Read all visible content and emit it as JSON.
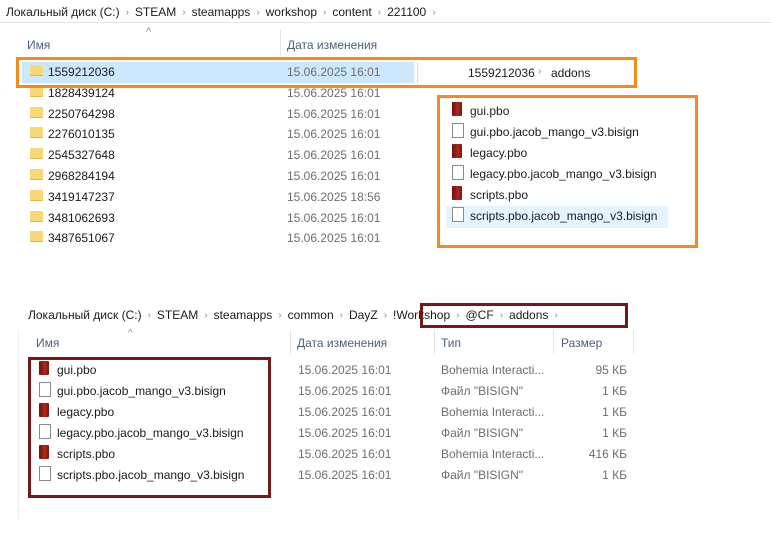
{
  "top": {
    "breadcrumb": [
      "Локальный диск (C:)",
      "STEAM",
      "steamapps",
      "workshop",
      "content",
      "221100"
    ],
    "columns": {
      "name": "Имя",
      "date": "Дата изменения"
    },
    "folders": [
      {
        "name": "1559212036",
        "date": "15.06.2025 16:01"
      },
      {
        "name": "1828439124",
        "date": "15.06.2025 16:01"
      },
      {
        "name": "2250764298",
        "date": "15.06.2025 16:01"
      },
      {
        "name": "2276010135",
        "date": "15.06.2025 16:01"
      },
      {
        "name": "2545327648",
        "date": "15.06.2025 16:01"
      },
      {
        "name": "2968284194",
        "date": "15.06.2025 16:01"
      },
      {
        "name": "3419147237",
        "date": "15.06.2025 18:56"
      },
      {
        "name": "3481062693",
        "date": "15.06.2025 16:01"
      },
      {
        "name": "3487651067",
        "date": "15.06.2025 16:01"
      }
    ],
    "inner_breadcrumb": [
      "1559212036",
      "addons"
    ],
    "inner_files": [
      {
        "name": "gui.pbo",
        "icon": "pbo"
      },
      {
        "name": "gui.pbo.jacob_mango_v3.bisign",
        "icon": "doc"
      },
      {
        "name": "legacy.pbo",
        "icon": "pbo"
      },
      {
        "name": "legacy.pbo.jacob_mango_v3.bisign",
        "icon": "doc"
      },
      {
        "name": "scripts.pbo",
        "icon": "pbo"
      },
      {
        "name": "scripts.pbo.jacob_mango_v3.bisign",
        "icon": "doc"
      }
    ]
  },
  "bottom": {
    "breadcrumb": [
      "Локальный диск (C:)",
      "STEAM",
      "steamapps",
      "common",
      "DayZ",
      "!Workshop",
      "@CF",
      "addons"
    ],
    "columns": {
      "name": "Имя",
      "date": "Дата изменения",
      "type": "Тип",
      "size": "Размер"
    },
    "files": [
      {
        "name": "gui.pbo",
        "icon": "pbo",
        "date": "15.06.2025 16:01",
        "type": "Bohemia Interacti...",
        "size": "95 КБ"
      },
      {
        "name": "gui.pbo.jacob_mango_v3.bisign",
        "icon": "doc",
        "date": "15.06.2025 16:01",
        "type": "Файл \"BISIGN\"",
        "size": "1 КБ"
      },
      {
        "name": "legacy.pbo",
        "icon": "pbo",
        "date": "15.06.2025 16:01",
        "type": "Bohemia Interacti...",
        "size": "1 КБ"
      },
      {
        "name": "legacy.pbo.jacob_mango_v3.bisign",
        "icon": "doc",
        "date": "15.06.2025 16:01",
        "type": "Файл \"BISIGN\"",
        "size": "1 КБ"
      },
      {
        "name": "scripts.pbo",
        "icon": "pbo",
        "date": "15.06.2025 16:01",
        "type": "Bohemia Interacti...",
        "size": "416 КБ"
      },
      {
        "name": "scripts.pbo.jacob_mango_v3.bisign",
        "icon": "doc",
        "date": "15.06.2025 16:01",
        "type": "Файл \"BISIGN\"",
        "size": "1 КБ"
      }
    ]
  },
  "colors": {
    "highlight_orange": "#f28a1e",
    "highlight_darkred": "#751818",
    "selection": "#cce8ff"
  }
}
